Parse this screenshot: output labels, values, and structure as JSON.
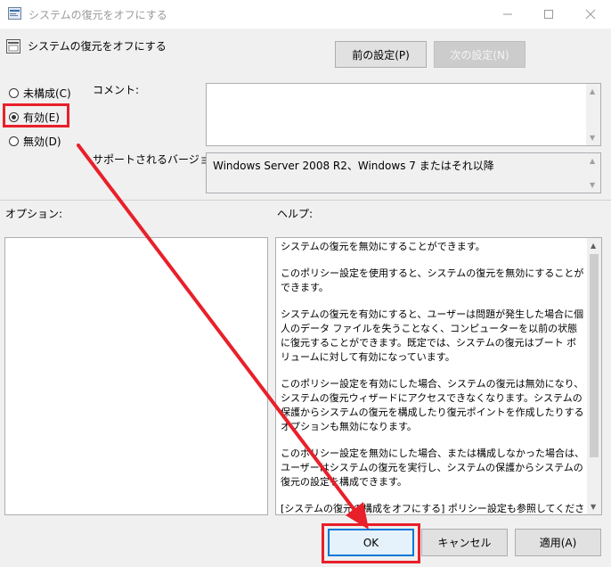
{
  "window": {
    "title": "システムの復元をオフにする"
  },
  "header": {
    "policy_name": "システムの復元をオフにする"
  },
  "nav": {
    "prev_label": "前の設定(P)",
    "next_label": "次の設定(N)"
  },
  "state": {
    "not_configured": "未構成(C)",
    "enabled": "有効(E)",
    "disabled": "無効(D)",
    "selected": "enabled"
  },
  "comment": {
    "label": "コメント:",
    "value": ""
  },
  "supported": {
    "label": "サポートされるバージョン:",
    "value": "Windows Server 2008 R2、Windows 7 またはそれ以降"
  },
  "options": {
    "label": "オプション:"
  },
  "help": {
    "label": "ヘルプ:",
    "paragraphs": [
      "システムの復元を無効にすることができます。",
      "このポリシー設定を使用すると、システムの復元を無効にすることができます。",
      "システムの復元を有効にすると、ユーザーは問題が発生した場合に個人のデータ ファイルを失うことなく、コンピューターを以前の状態に復元することができます。既定では、システムの復元はブート ボリュームに対して有効になっています。",
      "このポリシー設定を有効にした場合、システムの復元は無効になり、システムの復元ウィザードにアクセスできなくなります。システムの保護からシステムの復元を構成したり復元ポイントを作成したりするオプションも無効になります。",
      "このポリシー設定を無効にした場合、または構成しなかった場合は、ユーザーはシステムの復元を実行し、システムの保護からシステムの復元の設定を構成できます。",
      "[システムの復元の構成をオフにする] ポリシー設定も参照してください。[システムの復元をオフにする] ポリシー設定を無効にした場合、または構成しなかった場合は、"
    ]
  },
  "footer": {
    "ok_label": "OK",
    "cancel_label": "キャンセル",
    "apply_label": "適用(A)"
  },
  "colors": {
    "annotation_red": "#e8202a"
  }
}
